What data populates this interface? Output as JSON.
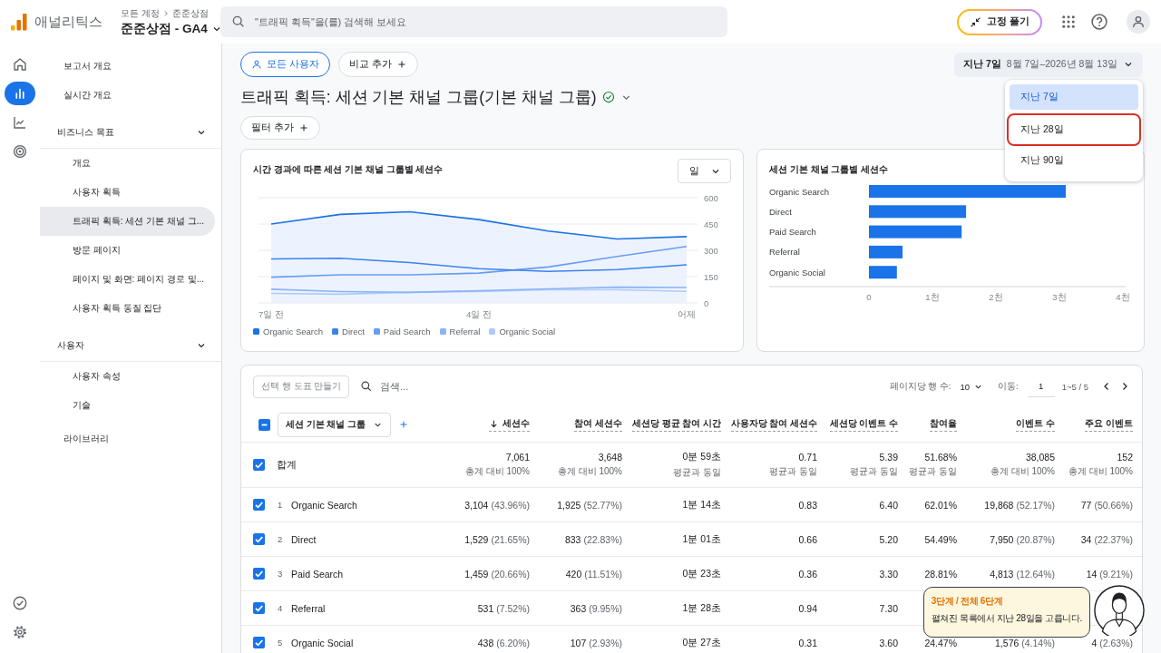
{
  "header": {
    "product": "애널리틱스",
    "breadcrumb": [
      "모든 계정",
      "준준상점"
    ],
    "property": "준준상점 - GA4",
    "search_placeholder": "\"트래픽 획득\"을(를) 검색해 보세요",
    "unpin_button": "고정 풀기"
  },
  "rail": [
    {
      "selected": false
    },
    {
      "selected": true
    },
    {
      "selected": false
    },
    {
      "selected": false
    }
  ],
  "sidebar": [
    {
      "label": "보고서 개요",
      "selected": false
    },
    {
      "label": "실시간 개요",
      "selected": false
    },
    {
      "label": "비즈니스 목표",
      "selected": false,
      "expanded": true,
      "children": [
        {
          "label": "개요",
          "selected": false
        },
        {
          "label": "사용자 획득",
          "selected": false
        },
        {
          "label": "트래픽 획득: 세션 기본 채널 그...",
          "selected": true
        },
        {
          "label": "방문 페이지",
          "selected": false
        },
        {
          "label": "페이지 및 화면: 페이지 경로 및...",
          "selected": false
        },
        {
          "label": "사용자 획득 동질 집단",
          "selected": false
        }
      ]
    },
    {
      "label": "사용자",
      "selected": false,
      "expanded": true,
      "children": [
        {
          "label": "사용자 속성",
          "selected": false
        },
        {
          "label": "기술",
          "selected": false
        }
      ]
    },
    {
      "label": "라이브러리",
      "selected": false
    }
  ],
  "toolbar": {
    "segment": "모든 사용자",
    "compare": "비교 추가",
    "date_preset": "지난 7일",
    "date_range": "8월 7일–2026년 8월 13일",
    "title": "트래픽 획득: 세션 기본 채널 그룹(기본 채널 그룹)",
    "verified": true,
    "filter": "필터 추가"
  },
  "date_menu": [
    {
      "label": "지난 7일",
      "selected": true,
      "highlighted": false
    },
    {
      "label": "지난 28일",
      "selected": false,
      "highlighted": true
    },
    {
      "label": "지난 90일",
      "selected": false,
      "highlighted": false
    }
  ],
  "line_card": {
    "title": "시간 경과에 따른 세션 기본 채널 그룹별 세션수",
    "granularity": "일",
    "chart_data": {
      "type": "line",
      "categories": [
        "7일 전",
        null,
        null,
        "4일 전",
        null,
        null,
        "어제"
      ],
      "grid": true,
      "ylim": [
        0,
        600
      ],
      "yticks": [
        0,
        150,
        300,
        450,
        600
      ],
      "series": [
        {
          "name": "Organic Search",
          "color": "#1a73e8",
          "values": [
            450,
            505,
            520,
            475,
            410,
            365,
            378
          ]
        },
        {
          "name": "Direct",
          "color": "#3b82ee",
          "values": [
            251,
            255,
            230,
            195,
            180,
            190,
            217
          ]
        },
        {
          "name": "Paid Search",
          "color": "#669df6",
          "values": [
            147,
            160,
            160,
            170,
            205,
            265,
            322
          ]
        },
        {
          "name": "Referral",
          "color": "#8ab4f8",
          "values": [
            78,
            65,
            60,
            70,
            80,
            90,
            88
          ]
        },
        {
          "name": "Organic Social",
          "color": "#aecbfa",
          "values": [
            54,
            50,
            60,
            65,
            75,
            75,
            66
          ]
        }
      ]
    }
  },
  "bar_card": {
    "title": "세션 기본 채널 그룹별 세션수",
    "chart_data": {
      "type": "bar",
      "orientation": "horizontal",
      "categories": [
        "Organic Search",
        "Direct",
        "Paid Search",
        "Referral",
        "Organic Social"
      ],
      "values": [
        3.1,
        1.53,
        1.46,
        0.53,
        0.44
      ],
      "xlim": [
        0,
        4
      ],
      "xticks": [
        {
          "value": 0,
          "label": "0"
        },
        {
          "value": 1,
          "label": "1천"
        },
        {
          "value": 2,
          "label": "2천"
        },
        {
          "value": 3,
          "label": "3천"
        },
        {
          "value": 4,
          "label": "4천"
        }
      ]
    }
  },
  "table": {
    "create_chart_button": {
      "label": "선택 행 도표 만들기",
      "disabled": true
    },
    "search_placeholder": "검색...",
    "rows_per_page_label": "페이지당 행 수:",
    "rows_per_page": "10",
    "goto_label": "이동:",
    "goto_value": "1",
    "range": "1~5 / 5",
    "select_all": {
      "indeterminate": true
    },
    "dimension": "세션 기본 채널 그룹",
    "columns": [
      {
        "label": "세션수",
        "sorted": true
      },
      {
        "label": "참여 세션수",
        "sorted": false
      },
      {
        "label": "세션당 평균 참여 시간",
        "sorted": false
      },
      {
        "label": "사용자당 참여 세션수",
        "sorted": false
      },
      {
        "label": "세션당 이벤트 수",
        "sorted": false
      },
      {
        "label": "참여율",
        "sorted": false
      },
      {
        "label": "이벤트 수",
        "sorted": false
      },
      {
        "label": "주요 이벤트",
        "sorted": false
      }
    ],
    "total": {
      "label": "합계",
      "checked": true,
      "cells": [
        {
          "value": "7,061",
          "note": "총계 대비 100%"
        },
        {
          "value": "3,648",
          "note": "총계 대비 100%"
        },
        {
          "value": "0분 59초",
          "note": "평균과 동일"
        },
        {
          "value": "0.71",
          "note": "평균과 동일"
        },
        {
          "value": "5.39",
          "note": "평균과 동일"
        },
        {
          "value": "51.68%",
          "note": "평균과 동일"
        },
        {
          "value": "38,085",
          "note": "총계 대비 100%"
        },
        {
          "value": "152",
          "note": "총계 대비 100%"
        }
      ]
    },
    "rows": [
      {
        "index": "1",
        "name": "Organic Search",
        "checked": true,
        "cells": [
          {
            "value": "3,104",
            "share": "(43.96%)"
          },
          {
            "value": "1,925",
            "share": "(52.77%)"
          },
          {
            "value": "1분 14초"
          },
          {
            "value": "0.83"
          },
          {
            "value": "6.40"
          },
          {
            "value": "62.01%"
          },
          {
            "value": "19,868",
            "share": "(52.17%)"
          },
          {
            "value": "77",
            "share": "(50.66%)"
          }
        ]
      },
      {
        "index": "2",
        "name": "Direct",
        "checked": true,
        "cells": [
          {
            "value": "1,529",
            "share": "(21.65%)"
          },
          {
            "value": "833",
            "share": "(22.83%)"
          },
          {
            "value": "1분 01초"
          },
          {
            "value": "0.66"
          },
          {
            "value": "5.20"
          },
          {
            "value": "54.49%"
          },
          {
            "value": "7,950",
            "share": "(20.87%)"
          },
          {
            "value": "34",
            "share": "(22.37%)"
          }
        ]
      },
      {
        "index": "3",
        "name": "Paid Search",
        "checked": true,
        "cells": [
          {
            "value": "1,459",
            "share": "(20.66%)"
          },
          {
            "value": "420",
            "share": "(11.51%)"
          },
          {
            "value": "0분 23초"
          },
          {
            "value": "0.36"
          },
          {
            "value": "3.30"
          },
          {
            "value": "28.81%"
          },
          {
            "value": "4,813",
            "share": "(12.64%)"
          },
          {
            "value": "14",
            "share": "(9.21%)"
          }
        ]
      },
      {
        "index": "4",
        "name": "Referral",
        "checked": true,
        "cells": [
          {
            "value": "531",
            "share": "(7.52%)"
          },
          {
            "value": "363",
            "share": "(9.95%)"
          },
          {
            "value": "1분 28초"
          },
          {
            "value": "0.94"
          },
          {
            "value": "7.30"
          }
        ]
      },
      {
        "index": "5",
        "name": "Organic Social",
        "checked": true,
        "cells": [
          {
            "value": "438",
            "share": "(6.20%)"
          },
          {
            "value": "107",
            "share": "(2.93%)"
          },
          {
            "value": "0분 27초"
          },
          {
            "value": "0.31"
          },
          {
            "value": "3.60"
          },
          {
            "value": "24.47%"
          },
          {
            "value": "1,576",
            "share": "(4.14%)"
          },
          {
            "value": "4",
            "share": "(2.63%)"
          }
        ]
      }
    ]
  },
  "tour": {
    "step": "3단계 / 전체 6단계",
    "message": "펼쳐진 목록에서 지난 28일을 고릅니다."
  }
}
